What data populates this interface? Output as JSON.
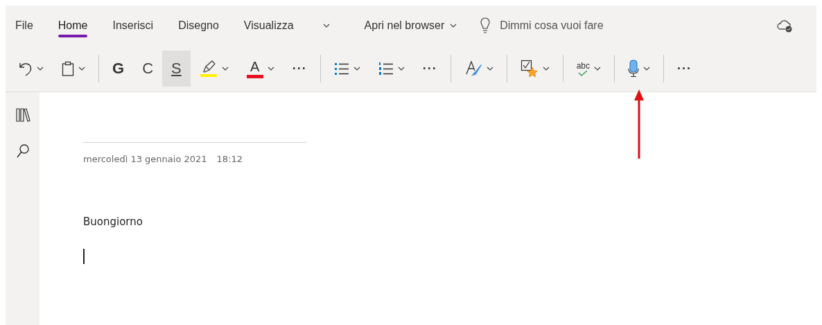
{
  "tabs": [
    {
      "label": "File",
      "selected": false
    },
    {
      "label": "Home",
      "selected": true
    },
    {
      "label": "Inserisci",
      "selected": false
    },
    {
      "label": "Disegno",
      "selected": false
    },
    {
      "label": "Visualizza",
      "selected": false
    }
  ],
  "open_in_browser": {
    "label": "Apri nel browser"
  },
  "search": {
    "placeholder": "Dimmi cosa vuoi fare"
  },
  "toolbar": [
    {
      "kind": "icon",
      "dropdown": true,
      "selected": false
    },
    {
      "kind": "icon",
      "dropdown": true,
      "selected": false
    },
    {
      "kind": "separator"
    },
    {
      "kind": "bold",
      "label": "G",
      "dropdown": false,
      "selected": false
    },
    {
      "kind": "letter",
      "label": "C",
      "dropdown": false,
      "selected": false
    },
    {
      "kind": "underlined",
      "label": "S",
      "dropdown": false,
      "selected": true
    },
    {
      "kind": "icon",
      "color": "#fff200",
      "dropdown": true,
      "selected": false
    },
    {
      "kind": "colorletter",
      "label": "A",
      "color": "#e81123",
      "dropdown": true,
      "selected": false
    },
    {
      "kind": "more",
      "label": "···",
      "dropdown": false,
      "selected": false
    },
    {
      "kind": "separator"
    },
    {
      "kind": "icon",
      "dropdown": true,
      "selected": false
    },
    {
      "kind": "icon",
      "dropdown": true,
      "selected": false
    },
    {
      "kind": "more",
      "label": "···",
      "dropdown": false,
      "selected": false
    },
    {
      "kind": "separator"
    },
    {
      "kind": "icon",
      "dropdown": true,
      "selected": false
    },
    {
      "kind": "separator"
    },
    {
      "kind": "icon",
      "dropdown": true,
      "selected": false
    },
    {
      "kind": "separator"
    },
    {
      "kind": "icon",
      "label": "abc",
      "dropdown": true,
      "selected": false
    },
    {
      "kind": "separator"
    },
    {
      "kind": "icon",
      "dropdown": true,
      "selected": false
    },
    {
      "kind": "separator"
    },
    {
      "kind": "more",
      "label": "···",
      "dropdown": false,
      "selected": false
    }
  ],
  "page": {
    "date": "mercoledì 13 gennaio 2021",
    "time": "18:12",
    "body": "Buongiorno"
  }
}
